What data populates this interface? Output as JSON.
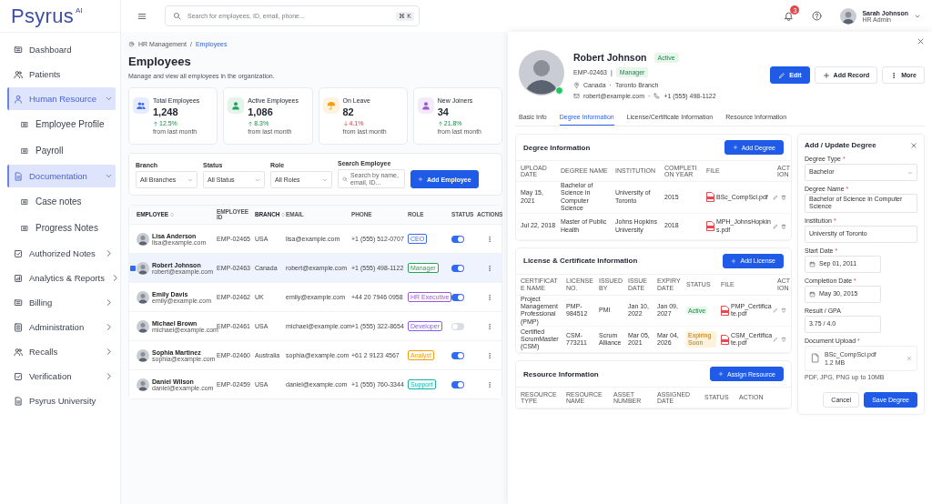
{
  "logo": {
    "name": "Psyrus",
    "badge": "AI"
  },
  "sidebar": {
    "items": [
      {
        "kind": "link",
        "label": "Dashboard"
      },
      {
        "kind": "link",
        "label": "Patients"
      },
      {
        "kind": "group",
        "label": "Human Resource",
        "expanded": true,
        "children": [
          {
            "label": "Employee Profile"
          },
          {
            "label": "Payroll"
          }
        ]
      },
      {
        "kind": "group",
        "label": "Documentation",
        "expanded": true,
        "children": [
          {
            "label": "Case notes"
          },
          {
            "label": "Progress Notes"
          }
        ]
      },
      {
        "kind": "group",
        "label": "Authorized Notes",
        "expanded": false
      },
      {
        "kind": "group",
        "label": "Analytics & Reports",
        "expanded": false
      },
      {
        "kind": "group",
        "label": "Billing",
        "expanded": false
      },
      {
        "kind": "group",
        "label": "Administration",
        "expanded": false
      },
      {
        "kind": "group",
        "label": "Recalls",
        "expanded": false
      },
      {
        "kind": "group",
        "label": "Verification",
        "expanded": false
      },
      {
        "kind": "link",
        "label": "Psyrus University"
      }
    ]
  },
  "header": {
    "search_placeholder": "Search for employees, ID, email, phone...",
    "shortcut": "⌘ K",
    "notifications": "3",
    "user": {
      "name": "Sarah Johnson",
      "role": "HR Admin"
    }
  },
  "breadcrumb": {
    "items": [
      "HR Management",
      "Employees"
    ],
    "separator": "/"
  },
  "title": "Employees",
  "subtitle": "Manage and view all employees in the organization.",
  "stats": [
    {
      "label": "Total Employees",
      "value": "1,248",
      "change": "12.5%",
      "rising": true,
      "note": "from last month",
      "color": "#3b6cf0"
    },
    {
      "label": "Active Employees",
      "value": "1,086",
      "change": "8.3%",
      "rising": true,
      "note": "from last month",
      "color": "#22a55a"
    },
    {
      "label": "On Leave",
      "value": "82",
      "change": "4.1%",
      "rising": false,
      "note": "from last month",
      "color": "#f59e0b"
    },
    {
      "label": "New Joiners",
      "value": "34",
      "change": "21.8%",
      "rising": true,
      "note": "from last month",
      "color": "#9b59d6"
    }
  ],
  "filters": [
    {
      "label": "Branch",
      "value": "All Branches"
    },
    {
      "label": "Status",
      "value": "All Status"
    },
    {
      "label": "Role",
      "value": "All Roles"
    }
  ],
  "employee_search": {
    "label": "Search Employee",
    "placeholder": "Search by name, email, ID..."
  },
  "add_employee": "Add Employee",
  "table": {
    "columns": [
      {
        "label": "EMPLOYEE",
        "sortable": true
      },
      {
        "label": "EMPLOYEE ID",
        "sortable": false
      },
      {
        "label": "BRANCH",
        "sortable": true
      },
      {
        "label": "EMAIL",
        "sortable": false
      },
      {
        "label": "PHONE",
        "sortable": false
      },
      {
        "label": "ROLE",
        "sortable": false
      },
      {
        "label": "STATUS",
        "sortable": false
      },
      {
        "label": "ACTIONS",
        "sortable": false
      }
    ],
    "rows": [
      {
        "name": "Lisa Anderson",
        "sub_email": "lisa@example.com",
        "id": "EMP-02465",
        "branch": "USA",
        "email": "lisa@example.com",
        "phone": "+1 (555) 512-0707",
        "role": "CEO",
        "color": "#3b6cf0",
        "on": true,
        "selected": false
      },
      {
        "name": "Robert Johnson",
        "sub_email": "robert@example.com",
        "id": "EMP-02463",
        "branch": "Canada",
        "email": "robert@example.com",
        "phone": "+1 (555) 498-1122",
        "role": "Manager",
        "color": "#22a55a",
        "on": true,
        "selected": true
      },
      {
        "name": "Emily Davis",
        "sub_email": "emily@example.com",
        "id": "EMP-02462",
        "branch": "UK",
        "email": "emily@example.com",
        "phone": "+44 20 7946 0958",
        "role": "HR Executive",
        "color": "#9b59d6",
        "on": true,
        "selected": false
      },
      {
        "name": "Michael Brown",
        "sub_email": "michael@example.com",
        "id": "EMP-02461",
        "branch": "USA",
        "email": "michael@example.com",
        "phone": "+1 (555) 322-8654",
        "role": "Developer",
        "color": "#8b5cf6",
        "on": false,
        "selected": false
      },
      {
        "name": "Sophia Martinez",
        "sub_email": "sophia@example.com",
        "id": "EMP-02460",
        "branch": "Australia",
        "email": "sophia@example.com",
        "phone": "+61 2 9123 4567",
        "role": "Analyst",
        "color": "#f59e0b",
        "on": true,
        "selected": false
      },
      {
        "name": "Daniel Wilson",
        "sub_email": "daniel@example.com",
        "id": "EMP-02459",
        "branch": "USA",
        "email": "daniel@example.com",
        "phone": "+1 (555) 760-3344",
        "role": "Support",
        "color": "#14b8a6",
        "on": true,
        "selected": false
      }
    ]
  },
  "detail": {
    "name": "Robert Johnson",
    "status": "Active",
    "id": "EMP-02463",
    "id_separator": "|",
    "role": "Manager",
    "country": "Canada",
    "location_separator": "·",
    "branch": "Toronto Branch",
    "email": "robert@example.com",
    "contact_separator": "·",
    "phone": "+1 (555) 498-1122",
    "buttons": [
      {
        "kind": "primary",
        "label": "Edit"
      },
      {
        "kind": "outline",
        "label": "Add Record"
      },
      {
        "kind": "outline",
        "label": "More"
      }
    ],
    "tabs": [
      {
        "label": "Basic Info",
        "selected": false
      },
      {
        "label": "Degree Information",
        "selected": true
      },
      {
        "label": "License/Certificate Information",
        "selected": false
      },
      {
        "label": "Resource Information",
        "selected": false
      }
    ]
  },
  "degree": {
    "title": "Degree Information",
    "button": "Add Degree",
    "columns": [
      "UPLOAD DATE",
      "DEGREE NAME",
      "INSTITUTION",
      "COMPLETION YEAR",
      "FILE",
      "ACTION"
    ],
    "rows": [
      {
        "date": "May 15, 2021",
        "name": "Bachelor of Science in Computer Science",
        "institution": "University of Toronto",
        "year": "2015",
        "file": "BSc_CompSci.pdf"
      },
      {
        "date": "Jul 22, 2018",
        "name": "Master of Public Health",
        "institution": "Johns Hopkins University",
        "year": "2018",
        "file": "MPH_JohnsHopkins.pdf"
      }
    ]
  },
  "license": {
    "title": "License & Certificate Information",
    "button": "Add License",
    "columns": [
      "CERTIFICATE NAME",
      "LICENSE NO.",
      "ISSUED BY",
      "ISSUE DATE",
      "EXPIRY DATE",
      "STATUS",
      "FILE",
      "ACTION"
    ],
    "rows": [
      {
        "name": "Project Management Professional (PMP)",
        "number": "PMP-984512",
        "issuer": "PMI",
        "issued": "Jan 10, 2022",
        "expiry": "Jan 09, 2027",
        "status": "Active",
        "kind": "active",
        "file": "PMP_Certificate.pdf"
      },
      {
        "name": "Certified ScrumMaster (CSM)",
        "number": "CSM-773211",
        "issuer": "Scrum Alliance",
        "issued": "Mar 05, 2021",
        "expiry": "Mar 04, 2026",
        "status": "Expiring Soon",
        "kind": "expiring",
        "file": "CSM_Certificate.pdf"
      }
    ]
  },
  "resource": {
    "title": "Resource Information",
    "button": "Assign Resource",
    "columns": [
      "RESOURCE TYPE",
      "RESOURCE NAME",
      "ASSET NUMBER",
      "ASSIGNED DATE",
      "STATUS",
      "ACTION"
    ]
  },
  "form": {
    "title": "Add / Update Degree",
    "required_mark": "*",
    "fields": [
      {
        "kind": "select",
        "label": "Degree Type",
        "required": true,
        "value": "Bachelor"
      },
      {
        "kind": "text",
        "label": "Degree Name",
        "required": true,
        "value": "Bachelor of Science in Computer Science"
      },
      {
        "kind": "text",
        "label": "Institution",
        "required": true,
        "value": "University of Toronto"
      },
      {
        "kind": "date",
        "label": "Start Date",
        "required": true,
        "value": "Sep 01, 2011"
      },
      {
        "kind": "date",
        "label": "Completion Date",
        "required": true,
        "value": "May 30, 2015"
      },
      {
        "kind": "short",
        "label": "Result / GPA",
        "required": false,
        "value": "3.75 / 4.0"
      }
    ],
    "upload": {
      "label": "Document Upload",
      "required": true,
      "file": "BSc_CompSci.pdf",
      "size": "1.2 MB",
      "hint": "PDF, JPG, PNG up to 10MB"
    },
    "buttons": [
      {
        "kind": "outline",
        "label": "Cancel"
      },
      {
        "kind": "primary",
        "label": "Save Degree"
      }
    ]
  }
}
